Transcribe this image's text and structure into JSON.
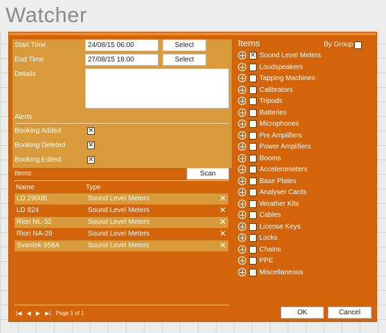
{
  "app": {
    "title": "Watcher"
  },
  "form": {
    "start_label": "Start Time",
    "start_value": "24/08/15 06:00",
    "end_label": "End Time",
    "end_value": "27/08/15 18:00",
    "select_label": "Select",
    "details_label": "Details",
    "details_value": ""
  },
  "alerts": {
    "title": "Alerts",
    "items": [
      {
        "label": "Booking Added",
        "checked": true
      },
      {
        "label": "Booking Deleted",
        "checked": true
      },
      {
        "label": "Booking Edited",
        "checked": true
      }
    ]
  },
  "items_table": {
    "title": "Items",
    "scan_label": "Scan",
    "headers": {
      "name": "Name",
      "type": "Type"
    },
    "rows": [
      {
        "name": "LD 2900B",
        "type": "Sound Level Meters"
      },
      {
        "name": "LD 824",
        "type": "Sound Level Meters"
      },
      {
        "name": "Rion NL-32",
        "type": "Sound Level Meters"
      },
      {
        "name": "Rion NA-28",
        "type": "Sound Level Meters"
      },
      {
        "name": "Svantek 958A",
        "type": "Sound Level Meters"
      }
    ]
  },
  "pager": {
    "text": "Page 1 of 1"
  },
  "items_panel": {
    "title": "Items",
    "by_group_label": "By Group",
    "list": [
      {
        "label": "Sound Level Meters",
        "checked": true
      },
      {
        "label": "Loudspeakers",
        "checked": false
      },
      {
        "label": "Tapping Machines",
        "checked": false
      },
      {
        "label": "Calibrators",
        "checked": false
      },
      {
        "label": "Tripods",
        "checked": false
      },
      {
        "label": "Batteries",
        "checked": false
      },
      {
        "label": "Microphones",
        "checked": false
      },
      {
        "label": "Pre Amplifiers",
        "checked": false
      },
      {
        "label": "Power Amplifiers",
        "checked": false
      },
      {
        "label": "Booms",
        "checked": false
      },
      {
        "label": "Accelerometers",
        "checked": false
      },
      {
        "label": "Base Plates",
        "checked": false
      },
      {
        "label": "Analyser Cards",
        "checked": false
      },
      {
        "label": "Weather Kits",
        "checked": false
      },
      {
        "label": "Cables",
        "checked": false
      },
      {
        "label": "License Keys",
        "checked": false
      },
      {
        "label": "Locks",
        "checked": false
      },
      {
        "label": "Chains",
        "checked": false
      },
      {
        "label": "PPE",
        "checked": false
      },
      {
        "label": "Miscellaneous",
        "checked": false
      }
    ]
  },
  "buttons": {
    "ok": "OK",
    "cancel": "Cancel"
  },
  "colors": {
    "dialog": "#d4640a",
    "panel": "#d89a3a",
    "accent": "#f08a2c"
  },
  "icons": [
    "close-icon",
    "add-circle-icon",
    "checkbox-icon",
    "first-page-icon",
    "prev-page-icon",
    "next-page-icon",
    "last-page-icon"
  ]
}
